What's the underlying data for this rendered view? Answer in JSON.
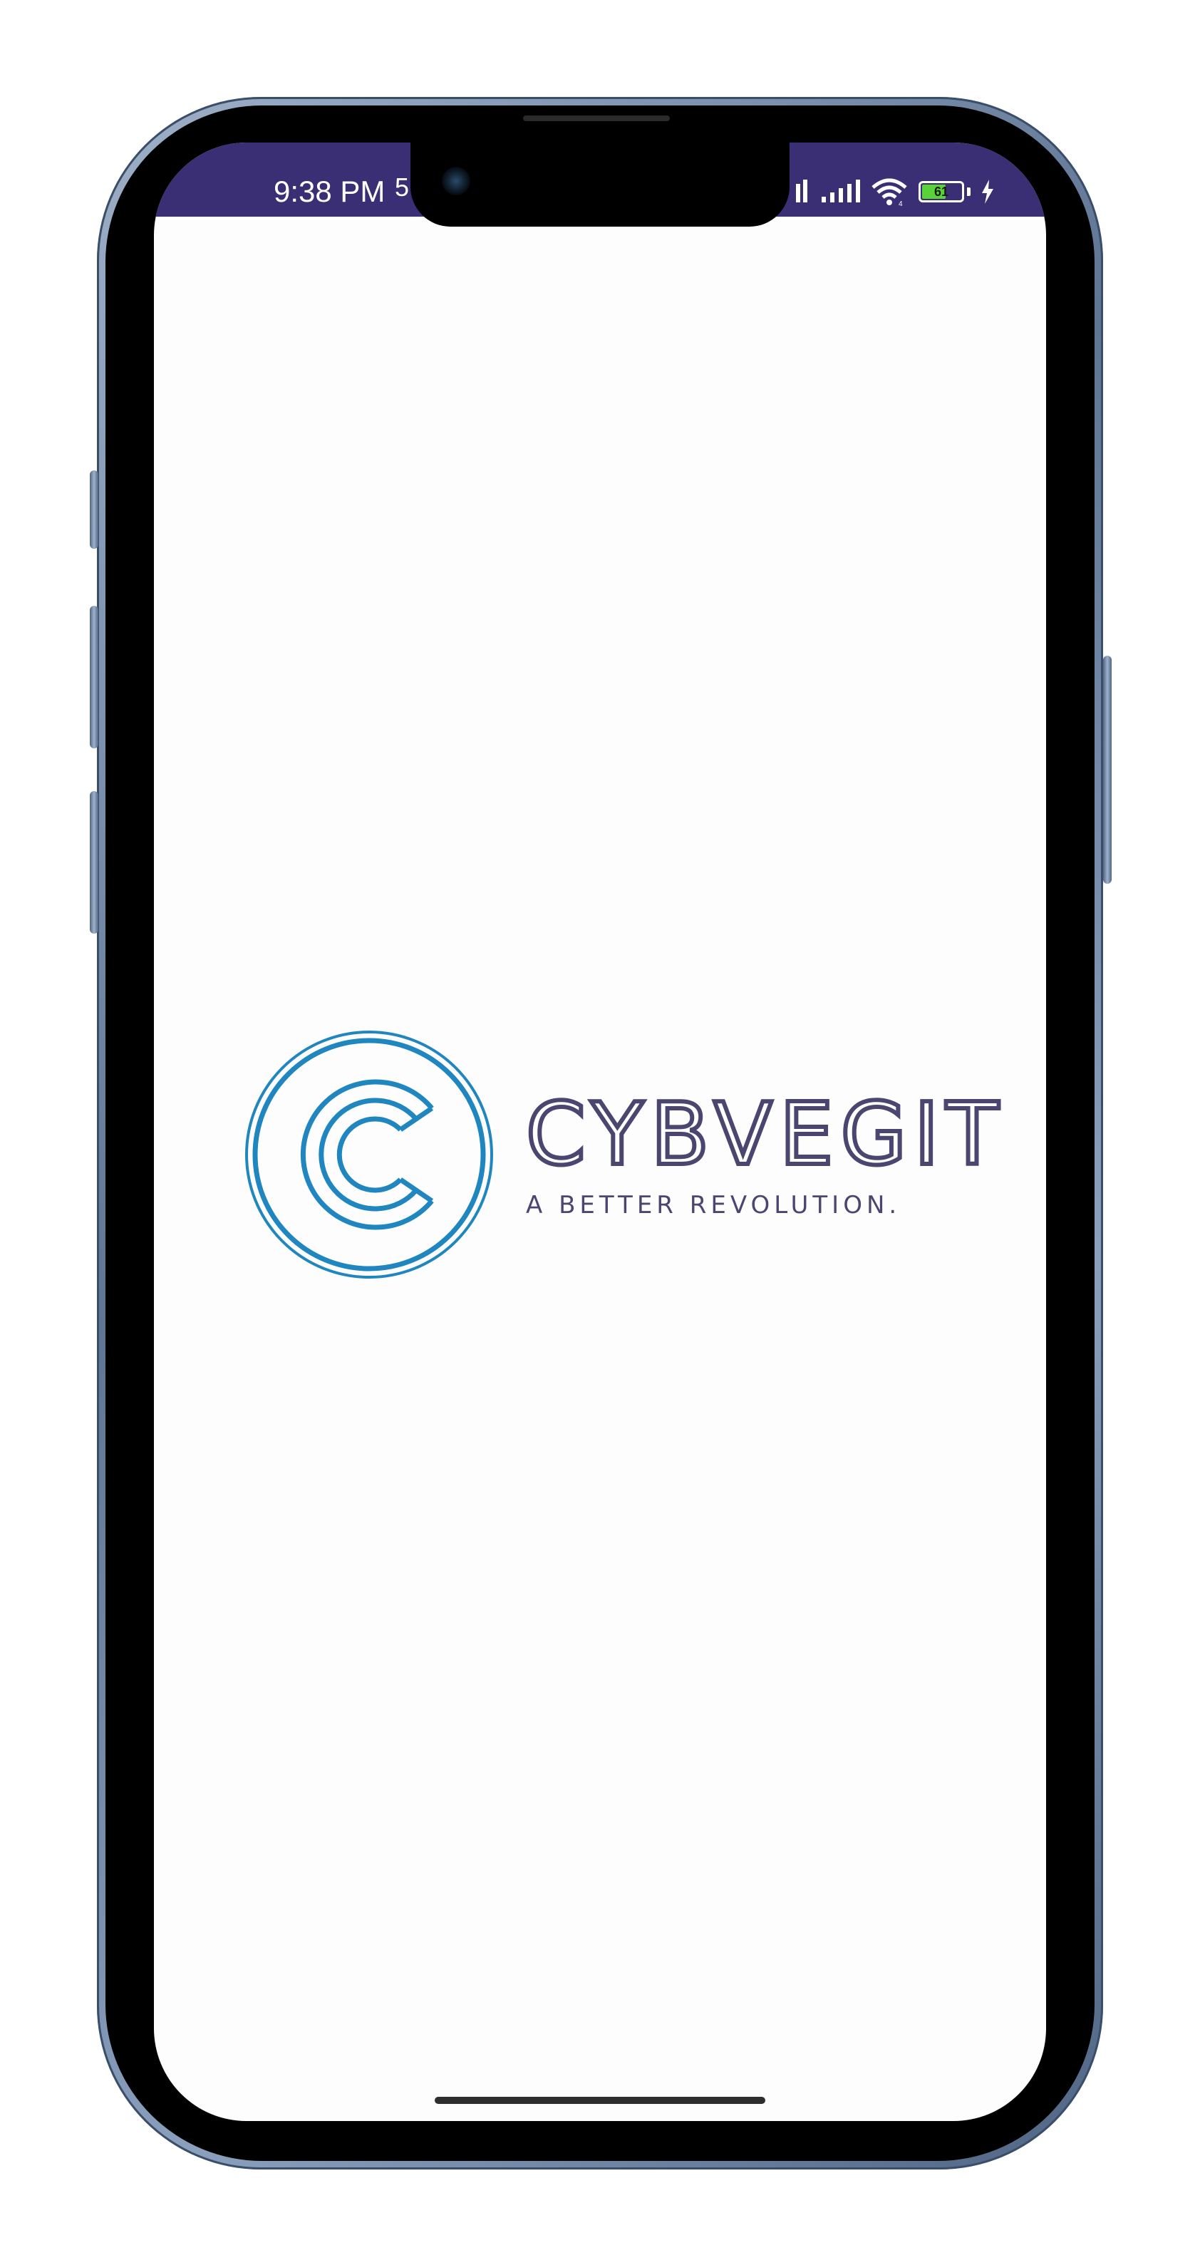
{
  "status_bar": {
    "time": "9:38 PM",
    "extra_indicator": "5",
    "battery_level": "61",
    "battery_fraction": 0.61,
    "background_color": "#3a2f74"
  },
  "splash": {
    "brand_name": "CYBVEGIT",
    "tagline": "A BETTER REVOLUTION.",
    "emblem_letter": "C",
    "brand_color": "#4a4670",
    "emblem_color": "#1f86c0"
  },
  "icons": {
    "signal_1": "cellular-signal-icon",
    "signal_2": "cellular-signal-icon",
    "wifi": "wifi-icon",
    "battery": "battery-icon",
    "charging": "charging-bolt-icon"
  }
}
